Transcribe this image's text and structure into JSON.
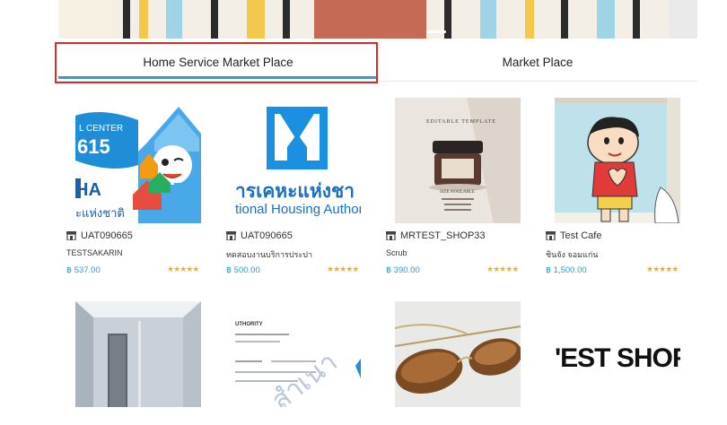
{
  "tabs": {
    "home_service": "Home Service Market Place",
    "market_place": "Market Place"
  },
  "products_row1": [
    {
      "shop": "UAT090665",
      "name": "TESTSAKARIN",
      "price": "฿ 537.00",
      "rating": "★★★★★",
      "thumb_text_1": "L CENTER",
      "thumb_text_2": "615",
      "thumb_text_3": "HA",
      "thumb_text_4": "ะแห่งชาติ"
    },
    {
      "shop": "UAT090665",
      "name": "ทดสอบงานบริการประปา",
      "price": "฿ 500.00",
      "rating": "★★★★★",
      "thumb_text_1": "ารเคหะแห่งชา",
      "thumb_text_2": "tional Housing Authori"
    },
    {
      "shop": "MRTEST_SHOP33",
      "name": "Scrub",
      "price": "฿ 390.00",
      "rating": "★★★★★",
      "thumb_text_1": "EDITABLE TEMPLATE",
      "thumb_text_2": "SIZE AVAILABLE"
    },
    {
      "shop": "Test Cafe",
      "name": "ชินจัง จอมแก่น",
      "price": "฿ 1,500.00",
      "rating": "★★★★★"
    }
  ],
  "products_row2": [
    {},
    {
      "thumb_text_1": "UTHORITY",
      "thumb_text_2": "สำเนา"
    },
    {},
    {
      "thumb_text_1": "'EST SHOF"
    }
  ],
  "colors": {
    "accent": "#24a4c6",
    "highlight": "#d52b2b",
    "price": "#2a9fc7",
    "stars": "#f2b01e"
  },
  "icons": {
    "shop": "store-icon"
  }
}
